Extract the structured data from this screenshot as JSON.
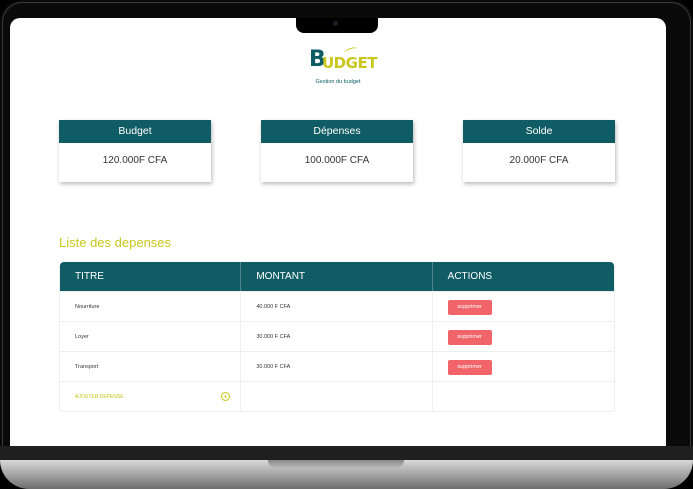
{
  "brand": {
    "logo_first_letter": "B",
    "logo_rest": "UDGET",
    "tagline": "Gestion du budget"
  },
  "summary": [
    {
      "label": "Budget",
      "value": "120.000F CFA"
    },
    {
      "label": "Dépenses",
      "value": "100.000F CFA"
    },
    {
      "label": "Solde",
      "value": "20.000F CFA"
    }
  ],
  "expenses": {
    "title": "Liste des depenses",
    "columns": [
      "TITRE",
      "MONTANT",
      "ACTIONS"
    ],
    "rows": [
      {
        "titre": "Nourriture",
        "montant": "40.000 F CFA",
        "action": "supprimer"
      },
      {
        "titre": "Loyer",
        "montant": "30.000 F CFA",
        "action": "supprimer"
      },
      {
        "titre": "Transport",
        "montant": "30.000 F CFA",
        "action": "supprimer"
      }
    ],
    "add_label": "AJOUTER DEPENSE"
  },
  "colors": {
    "primary": "#105c65",
    "accent": "#c9c71b",
    "danger": "#f0646a"
  },
  "icons": {
    "add": "plus-circle-icon",
    "camera": "camera-icon"
  }
}
